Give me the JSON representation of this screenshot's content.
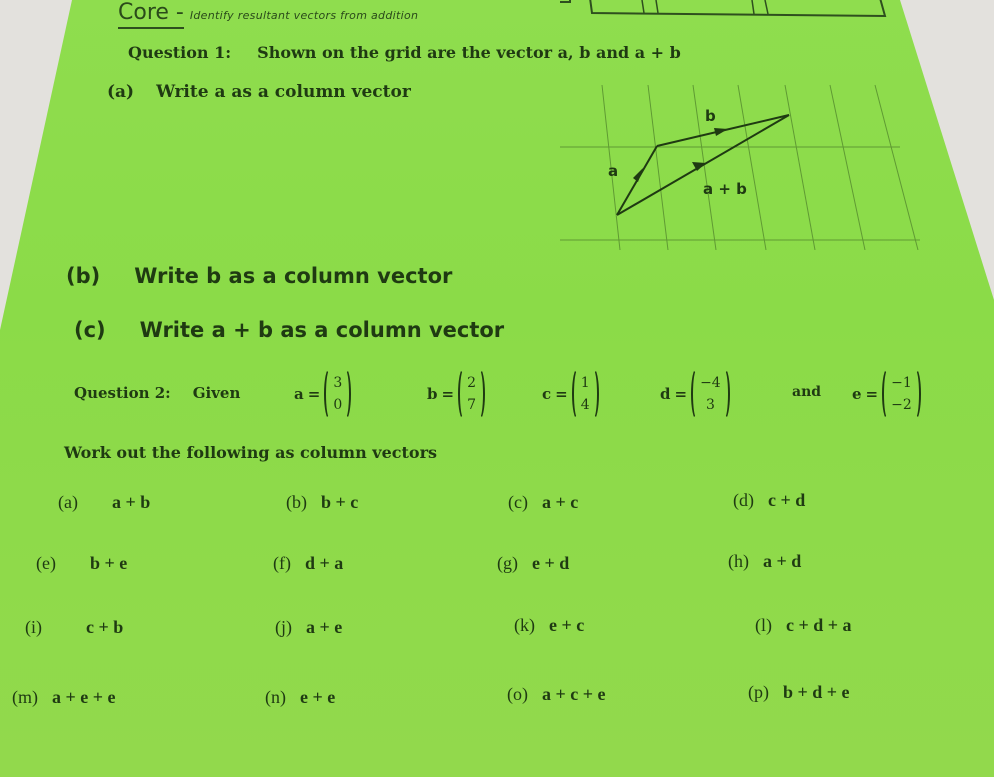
{
  "header": {
    "title": "Core -",
    "subtitle": "Identify resultant vectors from addition"
  },
  "question1": {
    "label": "Question 1:",
    "text": "Shown on the grid are the vector a, b and a + b",
    "parts": [
      {
        "label": "(a)",
        "text": "Write  a  as a column vector"
      },
      {
        "label": "(b)",
        "text": "Write  b  as a column vector"
      },
      {
        "label": "(c)",
        "text": "Write  a + b  as a column vector"
      }
    ],
    "diagram": {
      "labels": {
        "a": "a",
        "b": "b",
        "sum": "a + b"
      }
    }
  },
  "question2": {
    "label": "Question 2:",
    "given": "Given",
    "and": "and",
    "vectors": [
      {
        "name": "a",
        "top": "3",
        "bottom": "0"
      },
      {
        "name": "b",
        "top": "2",
        "bottom": "7"
      },
      {
        "name": "c",
        "top": "1",
        "bottom": "4"
      },
      {
        "name": "d",
        "top": "−4",
        "bottom": "3"
      },
      {
        "name": "e",
        "top": "−1",
        "bottom": "−2"
      }
    ],
    "instruction": "Work out the following as column vectors",
    "parts": [
      {
        "label": "(a)",
        "expr": "a + b"
      },
      {
        "label": "(b)",
        "expr": "b + c"
      },
      {
        "label": "(c)",
        "expr": "a + c"
      },
      {
        "label": "(d)",
        "expr": "c + d"
      },
      {
        "label": "(e)",
        "expr": "b + e"
      },
      {
        "label": "(f)",
        "expr": "d + a"
      },
      {
        "label": "(g)",
        "expr": "e + d"
      },
      {
        "label": "(h)",
        "expr": "a + d"
      },
      {
        "label": "(i)",
        "expr": "c + b"
      },
      {
        "label": "(j)",
        "expr": "a + e"
      },
      {
        "label": "(k)",
        "expr": "e + c"
      },
      {
        "label": "(l)",
        "expr": "c + d + a"
      },
      {
        "label": "(m)",
        "expr": "a + e + e"
      },
      {
        "label": "(n)",
        "expr": "e + e"
      },
      {
        "label": "(o)",
        "expr": "a + c + e"
      },
      {
        "label": "(p)",
        "expr": "b + d + e"
      }
    ]
  },
  "colors": {
    "paper": "#8fdd4e",
    "ink": "#1f3a12",
    "background": "#e3e1dd"
  }
}
